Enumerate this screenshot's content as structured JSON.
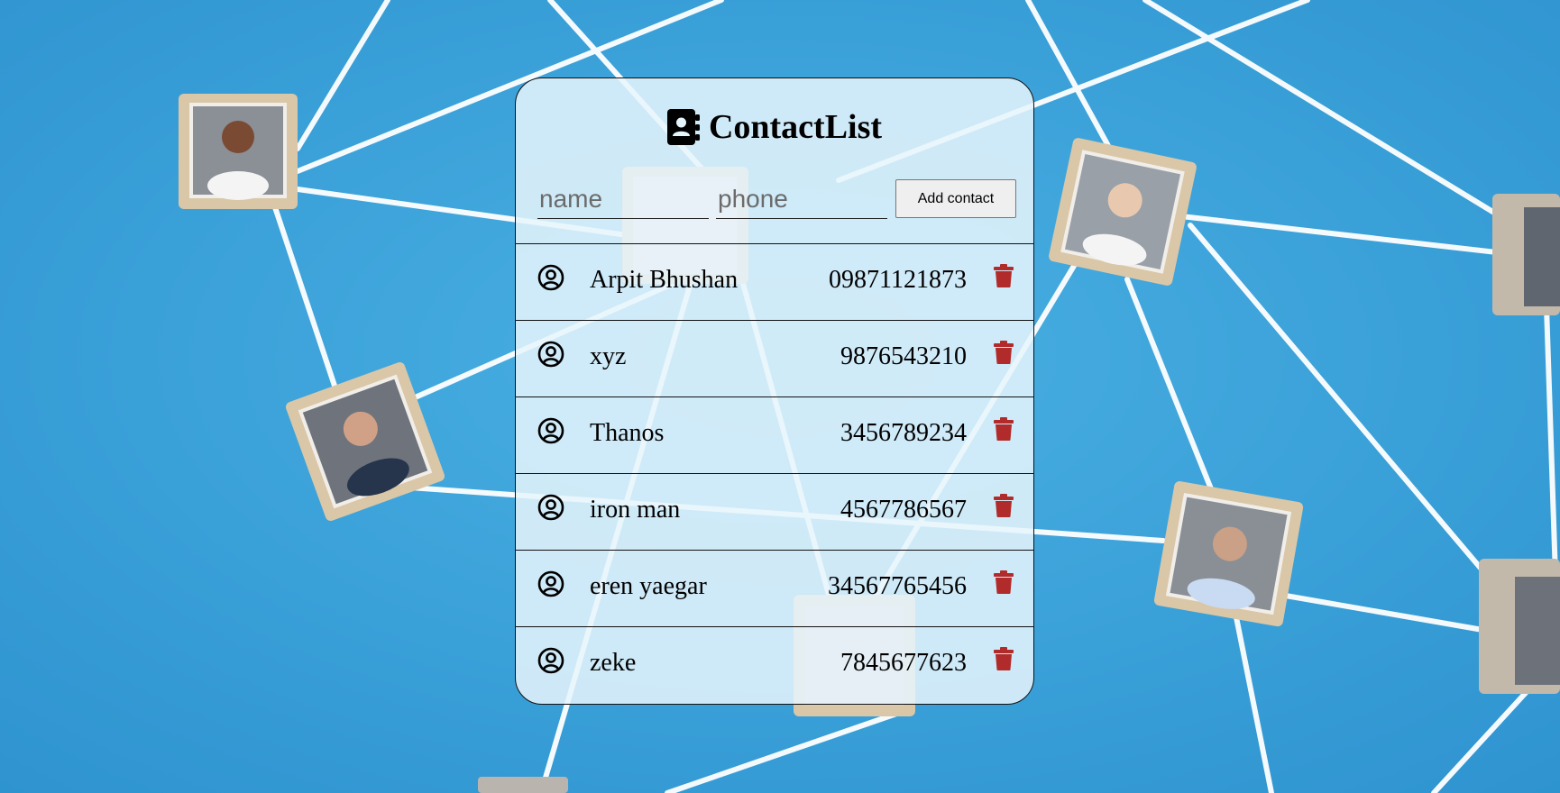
{
  "app": {
    "title": "ContactList"
  },
  "form": {
    "name_placeholder": "name",
    "phone_placeholder": "phone",
    "add_label": "Add contact"
  },
  "contacts": [
    {
      "name": "Arpit Bhushan",
      "phone": "09871121873"
    },
    {
      "name": "xyz",
      "phone": "9876543210"
    },
    {
      "name": "Thanos",
      "phone": "3456789234"
    },
    {
      "name": "iron man",
      "phone": "4567786567"
    },
    {
      "name": "eren yaegar",
      "phone": "34567765456"
    },
    {
      "name": "zeke",
      "phone": "7845677623"
    }
  ],
  "icons": {
    "title": "address-book-icon",
    "contact": "user-circle-icon",
    "delete": "trash-icon"
  },
  "colors": {
    "background": "#3da6dc",
    "card": "#e6f5fc",
    "delete": "#b22b2b"
  }
}
